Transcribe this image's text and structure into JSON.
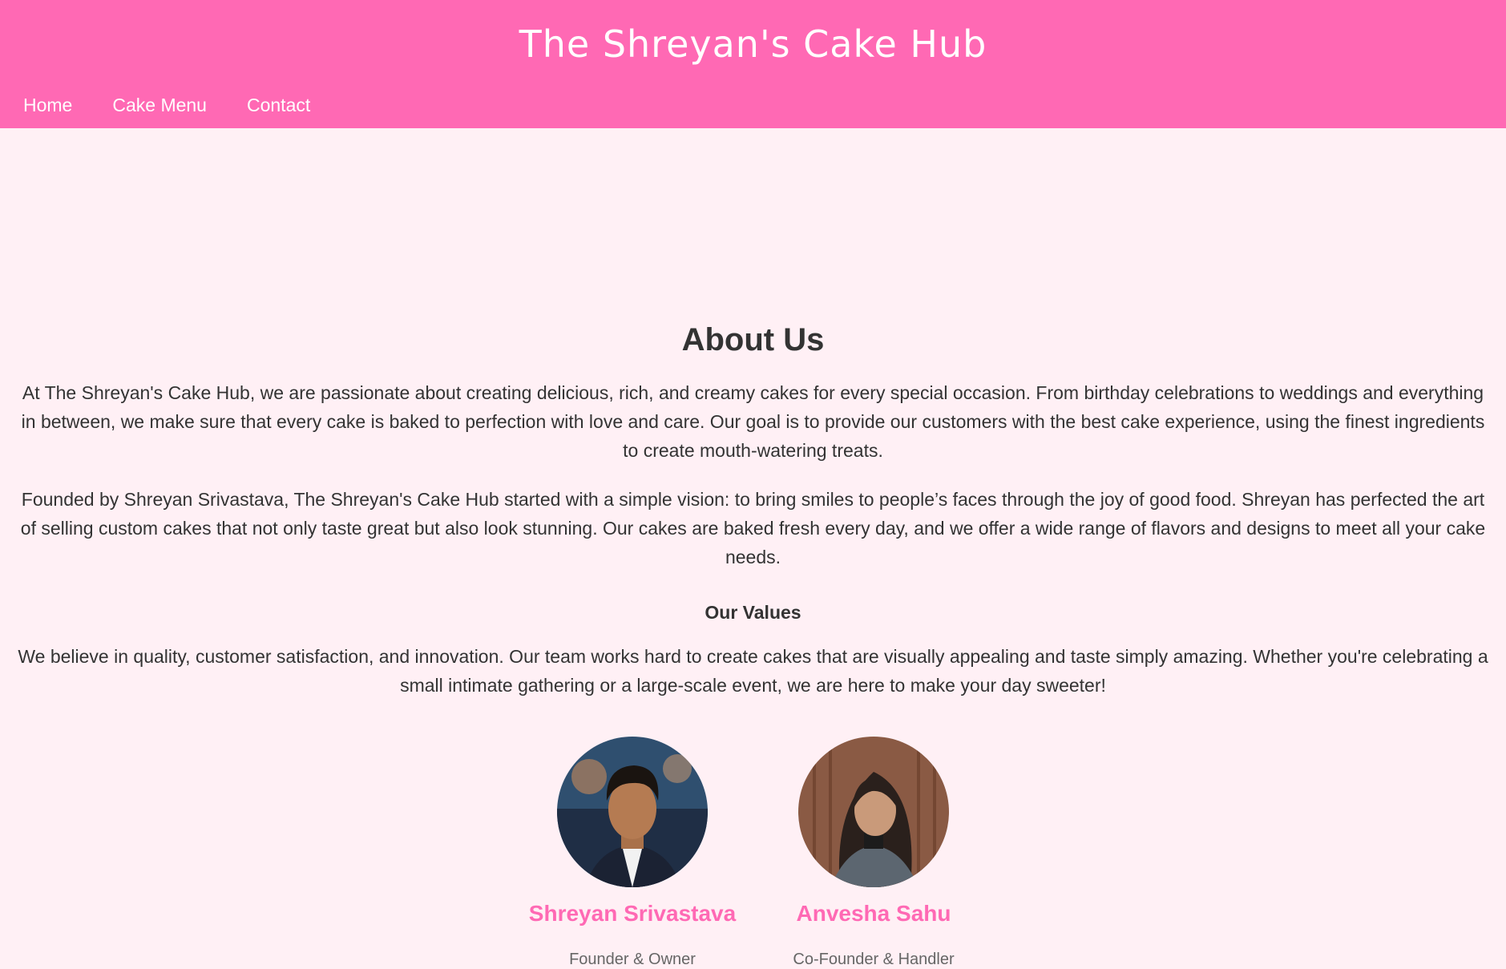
{
  "header": {
    "title": "The Shreyan's Cake Hub",
    "nav": [
      "Home",
      "Cake Menu",
      "Contact"
    ]
  },
  "about": {
    "heading": "About Us",
    "paragraph_1": "At The Shreyan's Cake Hub, we are passionate about creating delicious, rich, and creamy cakes for every special occasion. From birthday celebrations to weddings and everything in between, we make sure that every cake is baked to perfection with love and care. Our goal is to provide our customers with the best cake experience, using the finest ingredients to create mouth-watering treats.",
    "paragraph_2": "Founded by Shreyan Srivastava, The Shreyan's Cake Hub started with a simple vision: to bring smiles to people’s faces through the joy of good food. Shreyan has perfected the art of selling custom cakes that not only taste great but also look stunning. Our cakes are baked fresh every day, and we offer a wide range of flavors and designs to meet all your cake needs.",
    "values_heading": "Our Values",
    "paragraph_3": "We believe in quality, customer satisfaction, and innovation. Our team works hard to create cakes that are visually appealing and taste simply amazing. Whether you're celebrating a small intimate gathering or a large-scale event, we are here to make your day sweeter!"
  },
  "team": [
    {
      "name": "Shreyan Srivastava",
      "role": "Founder & Owner",
      "avatar": "man-portrait-photo"
    },
    {
      "name": "Anvesha Sahu",
      "role": "Co-Founder & Handler",
      "avatar": "woman-portrait-photo"
    }
  ],
  "colors": {
    "brand": "#ff69b4",
    "background": "#fff0f5",
    "text": "#333333",
    "muted": "#666666"
  }
}
